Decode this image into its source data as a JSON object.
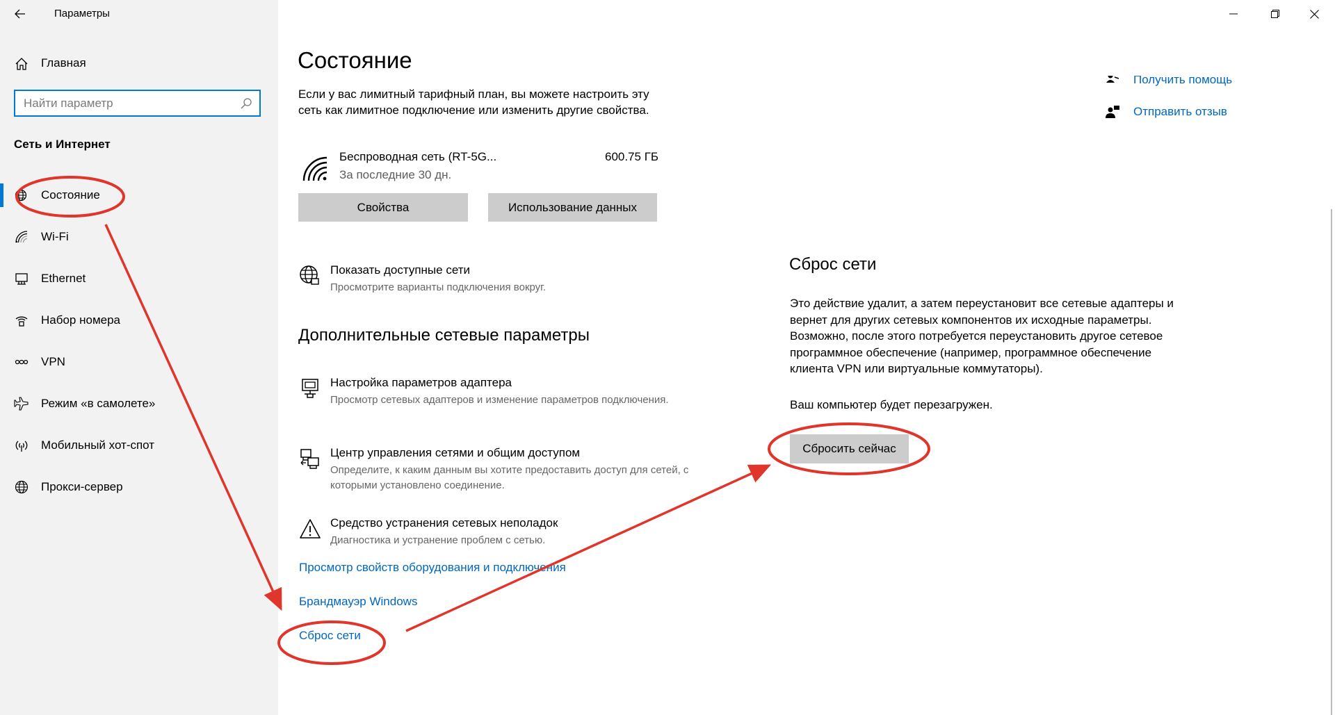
{
  "app": {
    "title": "Параметры"
  },
  "sidebar": {
    "home_label": "Главная",
    "search_placeholder": "Найти параметр",
    "section_title": "Сеть и Интернет",
    "items": [
      {
        "label": "Состояние",
        "icon": "globe-status-icon",
        "active": true
      },
      {
        "label": "Wi-Fi",
        "icon": "wifi-icon"
      },
      {
        "label": "Ethernet",
        "icon": "ethernet-icon"
      },
      {
        "label": "Набор номера",
        "icon": "dialup-icon"
      },
      {
        "label": "VPN",
        "icon": "vpn-icon"
      },
      {
        "label": "Режим «в самолете»",
        "icon": "airplane-icon"
      },
      {
        "label": "Мобильный хот-спот",
        "icon": "hotspot-icon"
      },
      {
        "label": "Прокси-сервер",
        "icon": "globe-icon"
      }
    ]
  },
  "main": {
    "title": "Состояние",
    "intro": "Если у вас лимитный тарифный план, вы можете настроить эту сеть как лимитное подключение или изменить другие свойства.",
    "network": {
      "name": "Беспроводная сеть (RT-5G...",
      "subtitle": "За последние 30 дн.",
      "usage": "600.75 ГБ",
      "properties_button": "Свойства",
      "data_usage_button": "Использование данных"
    },
    "show_networks": {
      "title": "Показать доступные сети",
      "desc": "Просмотрите варианты подключения вокруг."
    },
    "advanced_title": "Дополнительные сетевые параметры",
    "options": {
      "adapter": {
        "title": "Настройка параметров адаптера",
        "desc": "Просмотр сетевых адаптеров и изменение параметров подключения."
      },
      "center": {
        "title": "Центр управления сетями и общим доступом",
        "desc": "Определите, к каким данным вы хотите предоставить доступ для сетей, с которыми установлено соединение."
      },
      "troubleshoot": {
        "title": "Средство устранения сетевых неполадок",
        "desc": "Диагностика и устранение проблем с сетью."
      }
    },
    "links": {
      "hardware": "Просмотр свойств оборудования и подключения",
      "firewall": "Брандмауэр Windows",
      "reset": "Сброс сети"
    }
  },
  "right": {
    "help": "Получить помощь",
    "feedback": "Отправить отзыв"
  },
  "reset_panel": {
    "title": "Сброс сети",
    "desc": "Это действие удалит, а затем переустановит все сетевые адаптеры и вернет для других сетевых компонентов их исходные параметры. Возможно, после этого потребуется переустановить другое сетевое программное обеспечение (например, программное обеспечение клиента VPN или виртуальные коммутаторы).",
    "note": "Ваш компьютер будет перезагружен.",
    "button": "Сбросить сейчас"
  },
  "colors": {
    "accent": "#0078d7",
    "link": "#0067c0",
    "annotation": "#e0352b",
    "sidebar_bg": "#f2f2f2",
    "button_bg": "#cccccc"
  }
}
